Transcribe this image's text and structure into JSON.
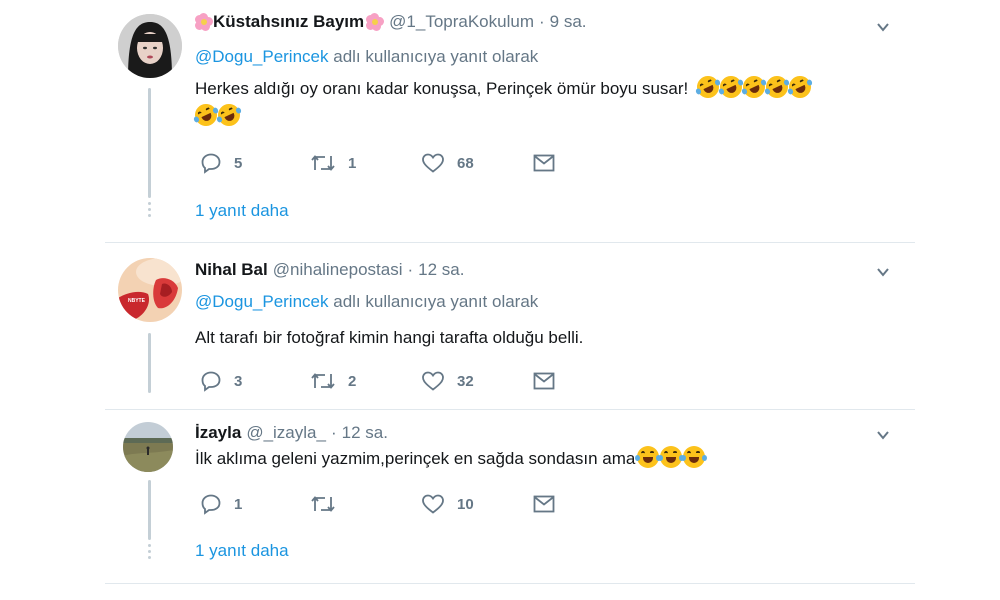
{
  "replies": [
    {
      "name": "Küstahsınız Bayım",
      "handle": "@1_TopraKokulum",
      "separator": "·",
      "time": "9 sa.",
      "reply_prefix": "@Dogu_Perincek",
      "reply_suffix": "adlı kullanıcıya yanıt olarak",
      "text": "Herkes aldığı oy oranı kadar konuşsa, Perinçek ömür boyu susar!",
      "reply_count": "5",
      "retweet_count": "1",
      "like_count": "68",
      "more_replies": "1 yanıt daha"
    },
    {
      "name": "Nihal Bal",
      "handle": "@nihalinepostasi",
      "separator": "·",
      "time": "12 sa.",
      "reply_prefix": "@Dogu_Perincek",
      "reply_suffix": "adlı kullanıcıya yanıt olarak",
      "text": "Alt tarafı bir fotoğraf kimin hangi tarafta olduğu belli.",
      "reply_count": "3",
      "retweet_count": "2",
      "like_count": "32"
    },
    {
      "name": "İzayla",
      "handle": "@_izayla_",
      "separator": "·",
      "time": "12 sa.",
      "text": "İlk aklıma geleni yazmim,perinçek en sağda sondasın ama",
      "reply_count": "1",
      "retweet_count": "",
      "like_count": "10",
      "more_replies": "1 yanıt daha"
    }
  ],
  "icons": {
    "reply": "reply-bubble",
    "retweet": "retweet-arrows",
    "like": "heart-outline",
    "dm": "envelope",
    "caret": "chevron-down"
  },
  "colors": {
    "link": "#1b95e0",
    "muted": "#657786",
    "thread_line": "#c4cfd6"
  }
}
